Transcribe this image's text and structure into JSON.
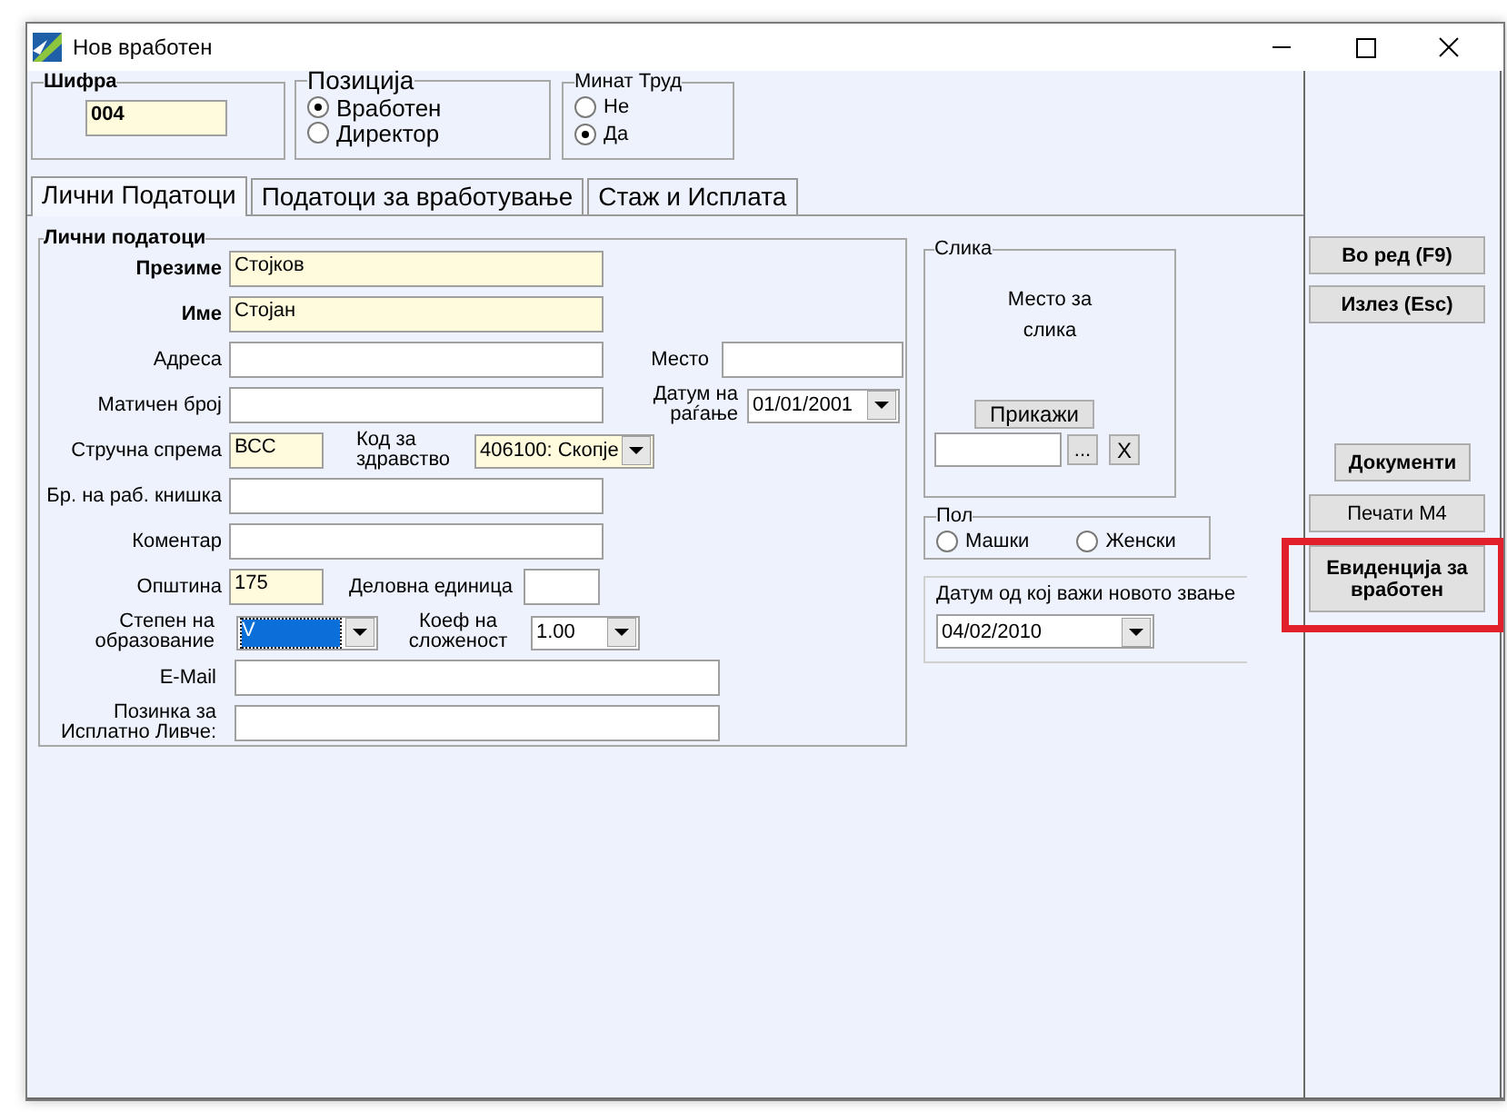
{
  "window": {
    "title": "Нов вработен"
  },
  "code": {
    "label": "Шифра",
    "value": "004"
  },
  "position": {
    "label": "Позиција",
    "options": [
      {
        "label": "Вработен",
        "selected": true
      },
      {
        "label": "Директор",
        "selected": false
      }
    ]
  },
  "past_work": {
    "label": "Минат Труд",
    "options": [
      {
        "label": "Не",
        "selected": false
      },
      {
        "label": "Да",
        "selected": true
      }
    ]
  },
  "tabs": [
    {
      "label": "Лични Податоци",
      "selected": true
    },
    {
      "label": "Податоци за вработување",
      "selected": false
    },
    {
      "label": "Стаж и Исплата",
      "selected": false
    }
  ],
  "personal": {
    "title": "Лични податоци",
    "surname": {
      "label": "Презиме",
      "value": "Стојков",
      "required": true,
      "label_bold": true
    },
    "name": {
      "label": "Име",
      "value": "Стојан",
      "required": true,
      "label_bold": true
    },
    "address": {
      "label": "Адреса",
      "required": false
    },
    "place": {
      "label": "Место",
      "required": false
    },
    "id_number": {
      "label": "Матичен број",
      "required": false
    },
    "birth_date": {
      "label": "Датум на\nраѓање",
      "value": "01/01/2001",
      "required": false
    },
    "qualification": {
      "label": "Стручна спрема",
      "value": "ВСС",
      "required": true
    },
    "health_code": {
      "label": "Код за\nздравство",
      "value": "406100: Скопје",
      "required": true
    },
    "work_book": {
      "label": "Бр. на раб. книшка",
      "required": false
    },
    "comment": {
      "label": "Коментар",
      "required": false
    },
    "municipality": {
      "label": "Општина",
      "value": "175",
      "required": true
    },
    "unit": {
      "label": "Деловна единица",
      "required": false
    },
    "education": {
      "label": "Степен на\nобразование",
      "value": "V",
      "required": false,
      "focused": true
    },
    "complexity": {
      "label": "Коеф на\nсложеност",
      "value": "1.00",
      "required": false
    },
    "email": {
      "label": "E-Mail",
      "required": false
    },
    "payslip_password": {
      "label": "Позинка за\nИсплатно Ливче:",
      "required": false
    }
  },
  "photo": {
    "title": "Слика",
    "placeholder_text": "Место за\nслика",
    "show_button": "Прикажи",
    "browse_button": "...",
    "clear_button": "X"
  },
  "gender": {
    "title": "Пол",
    "options": [
      {
        "label": "Машки",
        "selected": false
      },
      {
        "label": "Женски",
        "selected": false
      }
    ]
  },
  "title_date": {
    "label": "Датум од кој важи новото звање",
    "value": "04/02/2010",
    "required": false
  },
  "actions": {
    "top": [
      {
        "label": "Во ред (F9)",
        "bold": true,
        "highlighted": false
      },
      {
        "label": "Излез (Esc)",
        "bold": true,
        "highlighted": false
      }
    ],
    "bottom": [
      {
        "label": "Документи",
        "bold": true,
        "highlighted": false
      },
      {
        "label": "Печати М4",
        "bold": false,
        "highlighted": false
      },
      {
        "label": "Евиденција за\nвработен",
        "bold": true,
        "highlighted": true
      }
    ]
  }
}
